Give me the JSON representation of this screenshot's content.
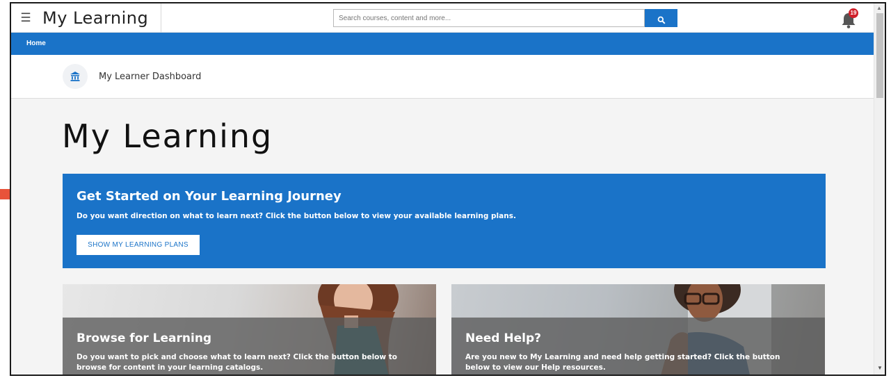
{
  "header": {
    "app_title": "My Learning",
    "search_placeholder": "Search courses, content and more...",
    "notification_count": "19",
    "icons": {
      "menu": "hamburger-menu-icon",
      "search": "search-icon",
      "notifications": "bell-icon"
    }
  },
  "breadcrumb": {
    "home_label": "Home"
  },
  "dashboard": {
    "title": "My Learner Dashboard",
    "icon": "institution-icon"
  },
  "page": {
    "title": "My Learning"
  },
  "hero": {
    "title": "Get Started on Your Learning Journey",
    "subtitle": "Do you want direction on what to learn next? Click the button below to view your available learning plans.",
    "button_label": "SHOW MY LEARNING PLANS"
  },
  "cards": [
    {
      "title": "Browse for Learning",
      "text_line1": "Do you want to pick and choose what to learn next? Click the button below to",
      "text_line2": "browse for content in your learning catalogs."
    },
    {
      "title": "Need Help?",
      "text_line1": "Are you new to My Learning and need help getting started? Click the button",
      "text_line2": "below to view our Help resources."
    }
  ],
  "annotation": {
    "arrow_color": "#e8533a"
  },
  "colors": {
    "brand_blue": "#1a73c8",
    "badge_red": "#d0202a"
  }
}
